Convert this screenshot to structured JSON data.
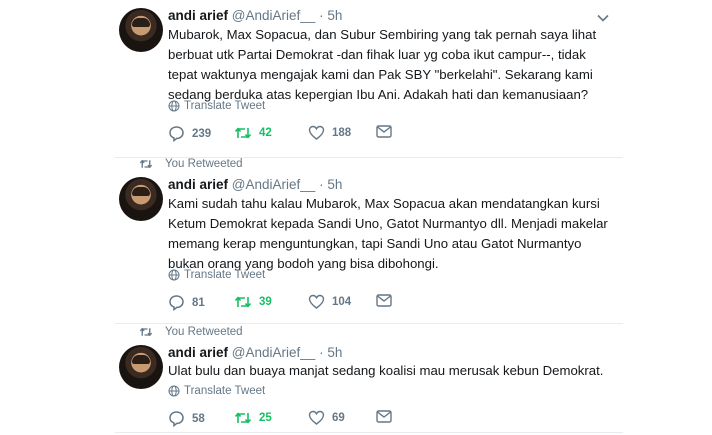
{
  "tweets": [
    {
      "retweeted_label": "",
      "name": "andi arief",
      "handle": "@AndiArief__",
      "dot": "·",
      "time": "5h",
      "text": "Mubarok, Max Sopacua, dan Subur Sembiring yang tak pernah saya lihat berbuat utk Partai Demokrat -dan fihak luar yg coba ikut campur--, tidak tepat waktunya mengajak kami dan Pak SBY \"berkelahi\". Sekarang kami sedang berduka atas kepergian Ibu Ani. Adakah hati dan kemanusiaan?",
      "translate": "Translate Tweet",
      "replies": "239",
      "retweets": "42",
      "likes": "188"
    },
    {
      "retweeted_label": "You Retweeted",
      "name": "andi arief",
      "handle": "@AndiArief__",
      "dot": "·",
      "time": "5h",
      "text": "Kami sudah tahu kalau Mubarok, Max Sopacua akan mendatangkan kursi Ketum Demokrat kepada Sandi Uno, Gatot  Nurmantyo dll. Menjadi makelar memang kerap menguntungkan, tapi Sandi Uno atau Gatot Nurmantyo bukan orang yang bodoh yang bisa dibohongi.",
      "translate": "Translate Tweet",
      "replies": "81",
      "retweets": "39",
      "likes": "104"
    },
    {
      "retweeted_label": "You Retweeted",
      "name": "andi arief",
      "handle": "@AndiArief__",
      "dot": "·",
      "time": "5h",
      "text": "Ulat bulu dan buaya manjat sedang koalisi mau merusak kebun Demokrat.",
      "translate": "Translate Tweet",
      "replies": "58",
      "retweets": "25",
      "likes": "69"
    }
  ],
  "colors": {
    "retweet_green": "#17bf63",
    "muted": "#657786",
    "text": "#14171a",
    "divider": "#e6ecf0"
  },
  "icons": [
    "reply-icon",
    "retweet-icon",
    "like-icon",
    "message-icon",
    "chevron-down-icon",
    "translate-globe-icon"
  ]
}
